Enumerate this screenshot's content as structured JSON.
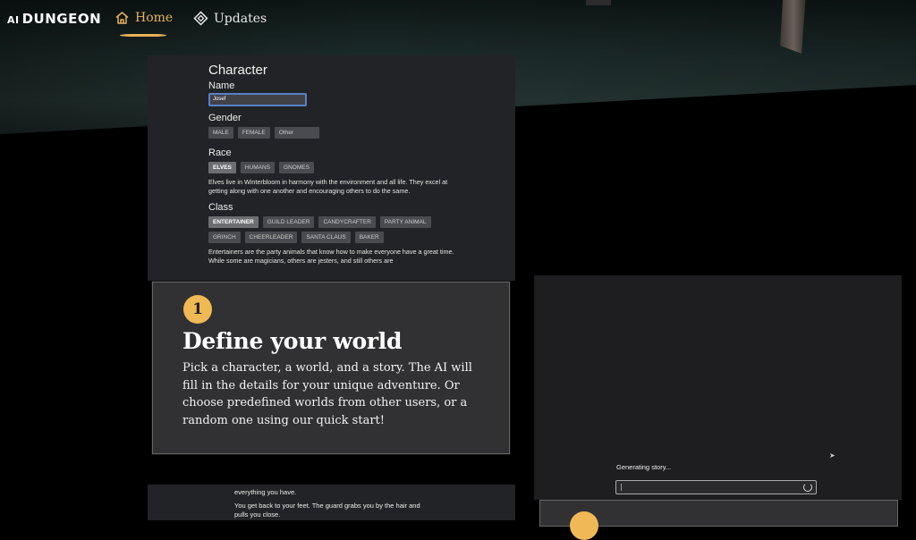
{
  "nav": {
    "logo_ai": "AI",
    "logo_name": "DUNGEON",
    "home": "Home",
    "updates": "Updates"
  },
  "character": {
    "title": "Character",
    "name_label": "Name",
    "name_value": "Josef",
    "gender_label": "Gender",
    "gender_options": [
      "MALE",
      "FEMALE",
      "Other"
    ],
    "race_label": "Race",
    "race_options": [
      "ELVES",
      "HUMANS",
      "GNOMES"
    ],
    "race_selected": "ELVES",
    "race_desc": "Elves live in Winterbloom in harmony with the environment and all life. They excel at getting along with one another and encouraging others to do the same.",
    "class_label": "Class",
    "class_options_row1": [
      "ENTERTAINER",
      "GUILD LEADER",
      "CANDYCRAFTER",
      "PARTY ANIMAL"
    ],
    "class_options_row2": [
      "GRINCH",
      "CHEERLEADER",
      "SANTA CLAUS",
      "BAKER"
    ],
    "class_selected": "ENTERTAINER",
    "class_desc": "Entertainers are the party animals that know how to make everyone have a great time. While some are magicians, others are jesters, and still others are"
  },
  "step1": {
    "number": "1",
    "title": "Define your world",
    "body": "Pick a character, a world, and a story. The AI will fill in the details for your unique adventure. Or choose predefined worlds from other users, or a random one using our quick start!"
  },
  "generating": {
    "label": "Generating story..."
  },
  "story": {
    "line1": "everything you have.",
    "line2": "You get back to your feet. The guard grabs you by the hair and pulls you close."
  },
  "colors": {
    "accent": "#e8b15a",
    "badge": "#f0b955",
    "card_bg": "#313133"
  }
}
